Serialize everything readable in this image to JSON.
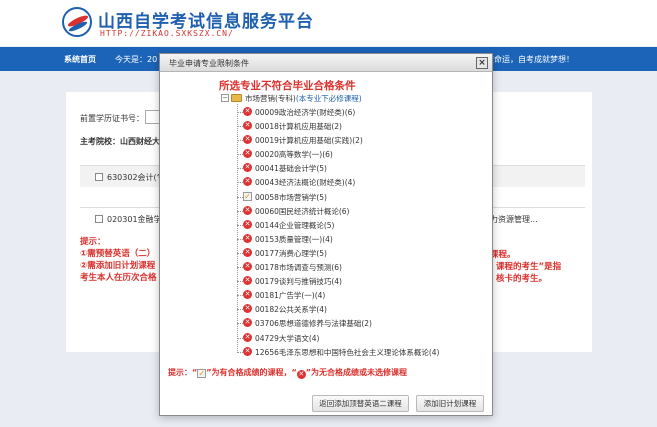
{
  "site": {
    "title": "山西自学考试信息服务平台",
    "url": "HTTP://ZIKAO.SXKSZX.CN/"
  },
  "nav": {
    "home": "系统首页",
    "today": "今天是：20",
    "slogan": "改变命运，自考成就梦想！"
  },
  "page": {
    "edu_label": "前置学历证书号：",
    "school_label": "主考院校：山西财经大",
    "rows": [
      {
        "text": "630302会计(专",
        "right": ""
      },
      {
        "text": "020301金融学(",
        "right": "力资源管理..."
      }
    ],
    "tip_lines": [
      "提示：",
      "①需预替英语（二）",
      "②需添加旧计划课程",
      "考生本人在历次合格"
    ],
    "tip_right": [
      "课程。",
      "课程的考生”是指",
      "核卡的考生。"
    ]
  },
  "modal": {
    "title": "毕业申请专业限制条件",
    "close": "×",
    "heading": "所选专业不符合毕业合格条件",
    "root": {
      "label": "市场营销(专科)",
      "sub": "(本专业下必修课程)"
    },
    "courses": [
      {
        "name": "00009政治经济学(财经类)(6)",
        "status": "fail"
      },
      {
        "name": "00018计算机应用基础(2)",
        "status": "fail"
      },
      {
        "name": "00019计算机应用基础(实践)(2)",
        "status": "fail"
      },
      {
        "name": "00020高等数学(一)(6)",
        "status": "fail"
      },
      {
        "name": "00041基础会计学(5)",
        "status": "fail"
      },
      {
        "name": "00043经济法概论(财经类)(4)",
        "status": "fail"
      },
      {
        "name": "00058市场营销学(5)",
        "status": "pass"
      },
      {
        "name": "00060国民经济统计概论(6)",
        "status": "fail"
      },
      {
        "name": "00144企业管理概论(5)",
        "status": "fail"
      },
      {
        "name": "00153质量管理(一)(4)",
        "status": "fail"
      },
      {
        "name": "00177消费心理学(5)",
        "status": "fail"
      },
      {
        "name": "00178市场调查与预测(6)",
        "status": "fail"
      },
      {
        "name": "00179谈判与推销技巧(4)",
        "status": "fail"
      },
      {
        "name": "00181广告学(一)(4)",
        "status": "fail"
      },
      {
        "name": "00182公共关系学(4)",
        "status": "fail"
      },
      {
        "name": "03706思想道德修养与法律基础(2)",
        "status": "fail"
      },
      {
        "name": "04729大学语文(4)",
        "status": "fail"
      },
      {
        "name": "12656毛泽东思想和中国特色社会主义理论体系概论(4)",
        "status": "fail"
      }
    ],
    "legend": {
      "prefix": "提示：“",
      "pass_text": "”为有合格成绩的课程，“",
      "fail_text": "”为无合格成绩或未选修课程"
    },
    "buttons": {
      "back": "返回添加顶替英语二课程",
      "old": "添加旧计划课程"
    }
  },
  "colors": {
    "brand_blue": "#1b64b8",
    "alert_red": "#d9322e",
    "fail_icon": "#e03030",
    "pass_check": "#e09a00"
  }
}
